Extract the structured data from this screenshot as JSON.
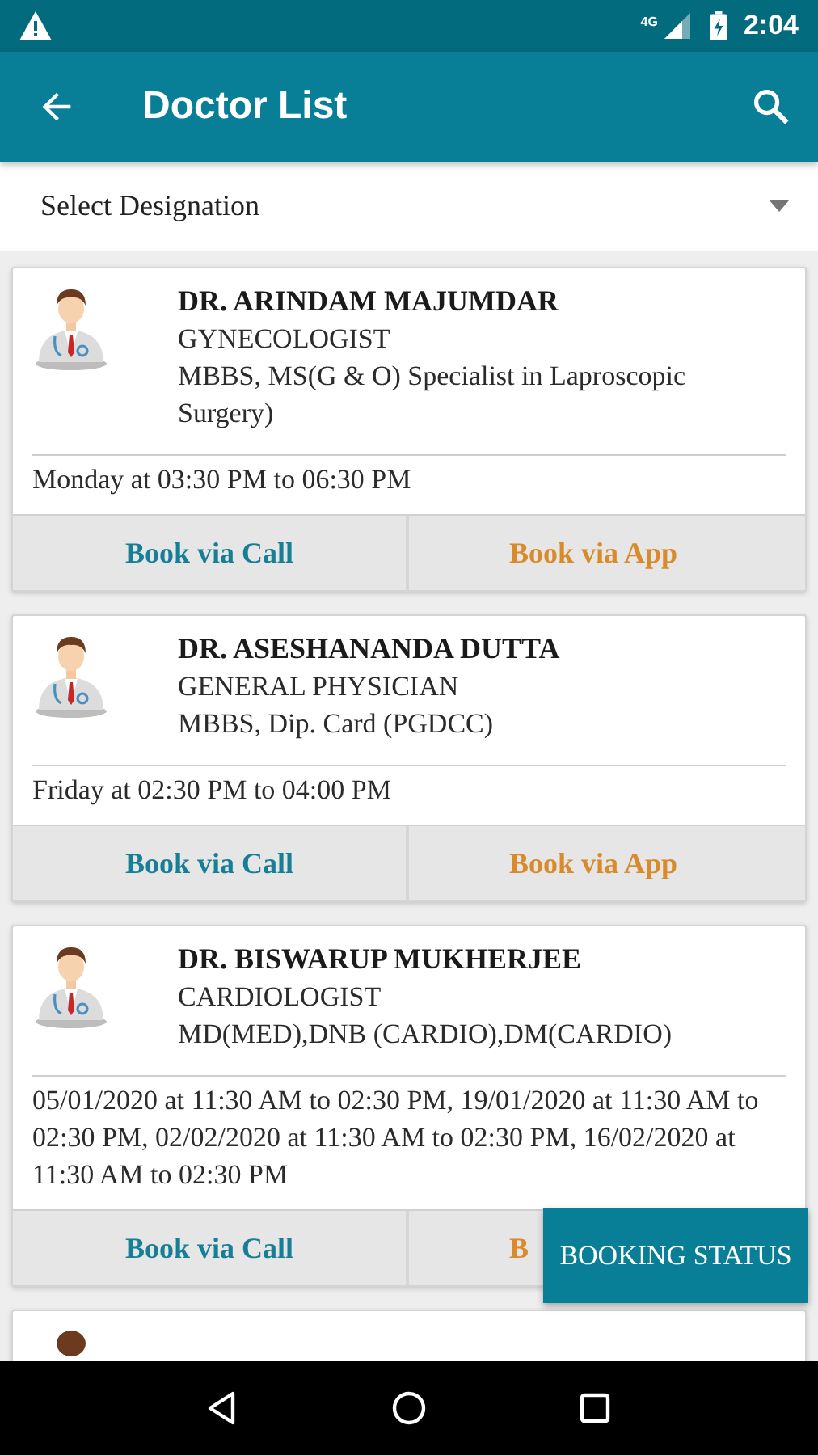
{
  "status_bar": {
    "time": "2:04",
    "network": "4G"
  },
  "app_bar": {
    "title": "Doctor List"
  },
  "designation_select": {
    "placeholder": "Select Designation"
  },
  "doctors": [
    {
      "name": "DR. ARINDAM MAJUMDAR",
      "designation": "GYNECOLOGIST",
      "qualification": "MBBS, MS(G & O) Specialist in Laproscopic Surgery)",
      "schedule": "Monday at 03:30 PM to 06:30 PM",
      "call_button": "Book via Call",
      "app_button": "Book via App"
    },
    {
      "name": "DR. ASESHANANDA DUTTA",
      "designation": "GENERAL PHYSICIAN",
      "qualification": "MBBS, Dip. Card (PGDCC)",
      "schedule": "Friday at 02:30 PM to 04:00 PM",
      "call_button": "Book via Call",
      "app_button": "Book via App"
    },
    {
      "name": "DR. BISWARUP MUKHERJEE",
      "designation": "CARDIOLOGIST",
      "qualification": "MD(MED),DNB (CARDIO),DM(CARDIO)",
      "schedule": "05/01/2020 at 11:30 AM to 02:30 PM, 19/01/2020 at 11:30 AM to 02:30 PM, 02/02/2020 at 11:30 AM to 02:30 PM, 16/02/2020 at 11:30 AM to 02:30 PM",
      "call_button": "Book via Call",
      "app_button": "B"
    },
    {
      "kind": "cut"
    }
  ],
  "booking_status_button": "BOOKING STATUS"
}
